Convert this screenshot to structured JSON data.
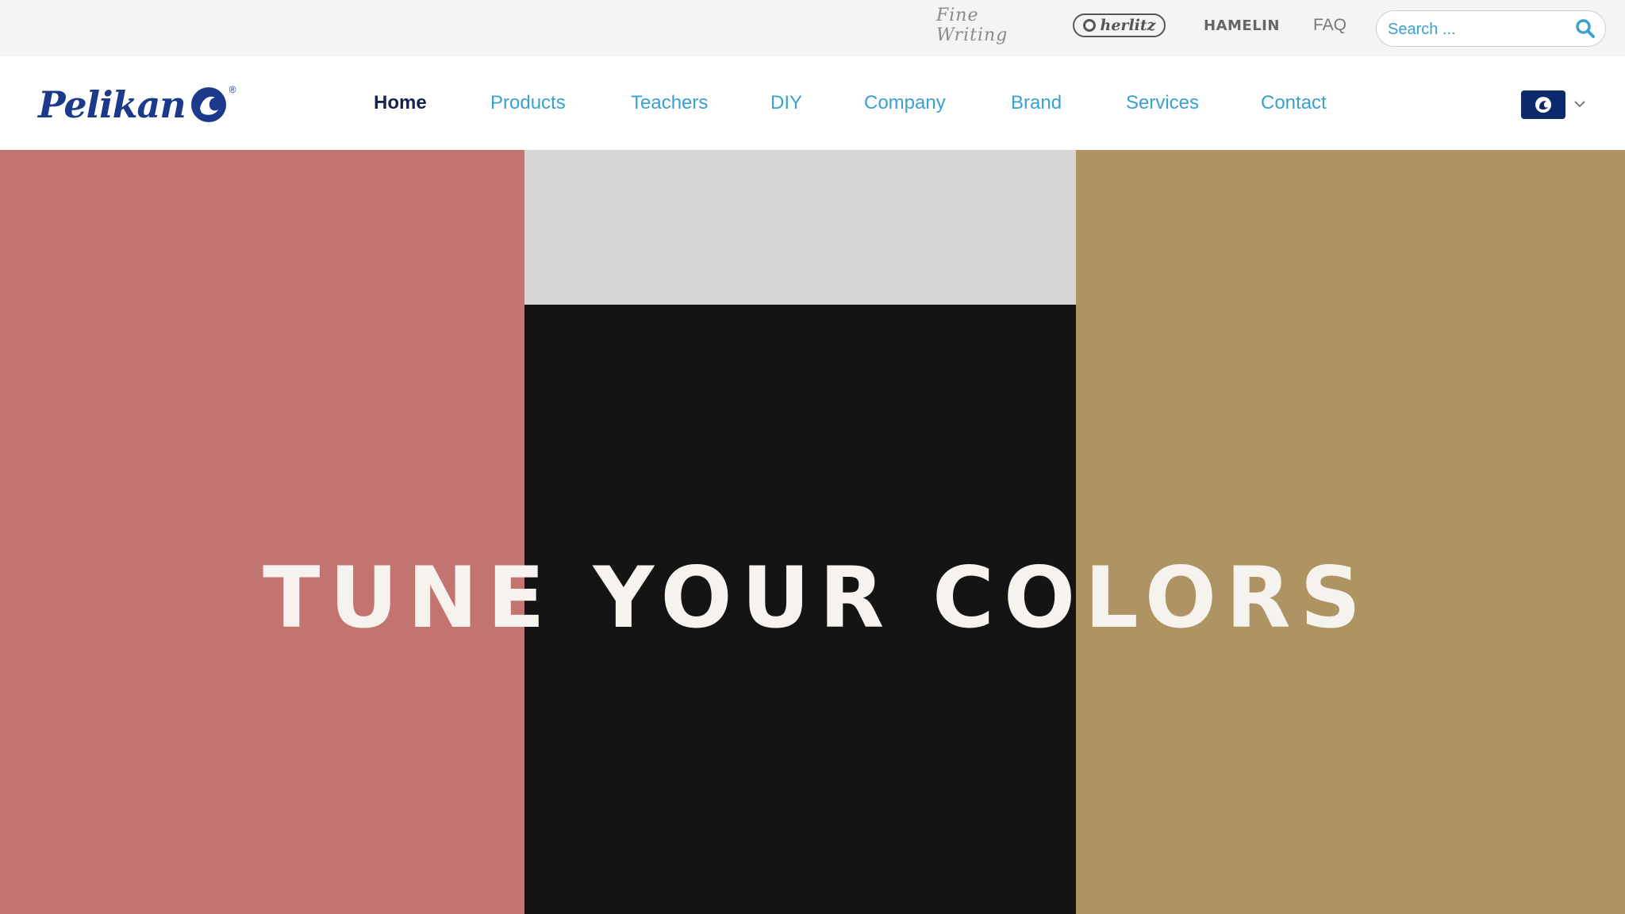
{
  "topbar": {
    "brands": [
      "Fine Writing",
      "herlitz",
      "HAMELIN"
    ],
    "faq_label": "FAQ",
    "search": {
      "placeholder": "Search ..."
    }
  },
  "header": {
    "logo_text": "Pelikan",
    "nav": [
      {
        "label": "Home",
        "active": true
      },
      {
        "label": "Products"
      },
      {
        "label": "Teachers"
      },
      {
        "label": "DIY"
      },
      {
        "label": "Company"
      },
      {
        "label": "Brand"
      },
      {
        "label": "Services"
      },
      {
        "label": "Contact"
      }
    ],
    "language_icon": "pelikan-flag-icon"
  },
  "hero": {
    "title": "TUNE YOUR COLORS",
    "panels": [
      {
        "color": "#c37470"
      },
      {
        "color": "#d6d6d6"
      },
      {
        "color": "#141414"
      },
      {
        "color": "#ae9462"
      }
    ]
  },
  "colors": {
    "accent": "#3aa0cf",
    "nav_active": "#14224d",
    "brand_blue": "#1b3a8c",
    "topbar_bg": "#f4f4f4"
  }
}
